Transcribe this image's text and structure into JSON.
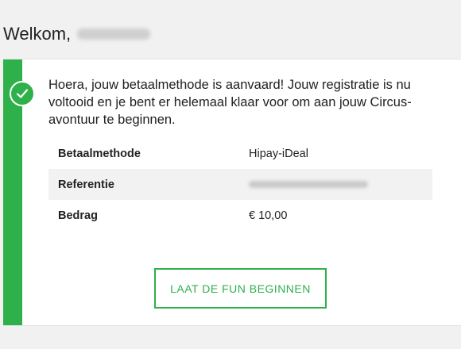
{
  "header": {
    "greeting": "Welkom,",
    "username_redacted": true
  },
  "confirmation": {
    "message": "Hoera, jouw betaalmethode is aanvaard! Jouw registratie is nu voltooid en je bent er helemaal klaar voor om aan jouw Circus-avontuur te beginnen.",
    "status_icon": "check-circle-icon",
    "accent_color": "#2eb04b"
  },
  "details": {
    "rows": [
      {
        "label": "Betaalmethode",
        "value": "Hipay-iDeal"
      },
      {
        "label": "Referentie",
        "value": ""
      },
      {
        "label": "Bedrag",
        "value": "€ 10,00"
      }
    ]
  },
  "actions": {
    "cta_label": "LAAT DE FUN BEGINNEN"
  }
}
